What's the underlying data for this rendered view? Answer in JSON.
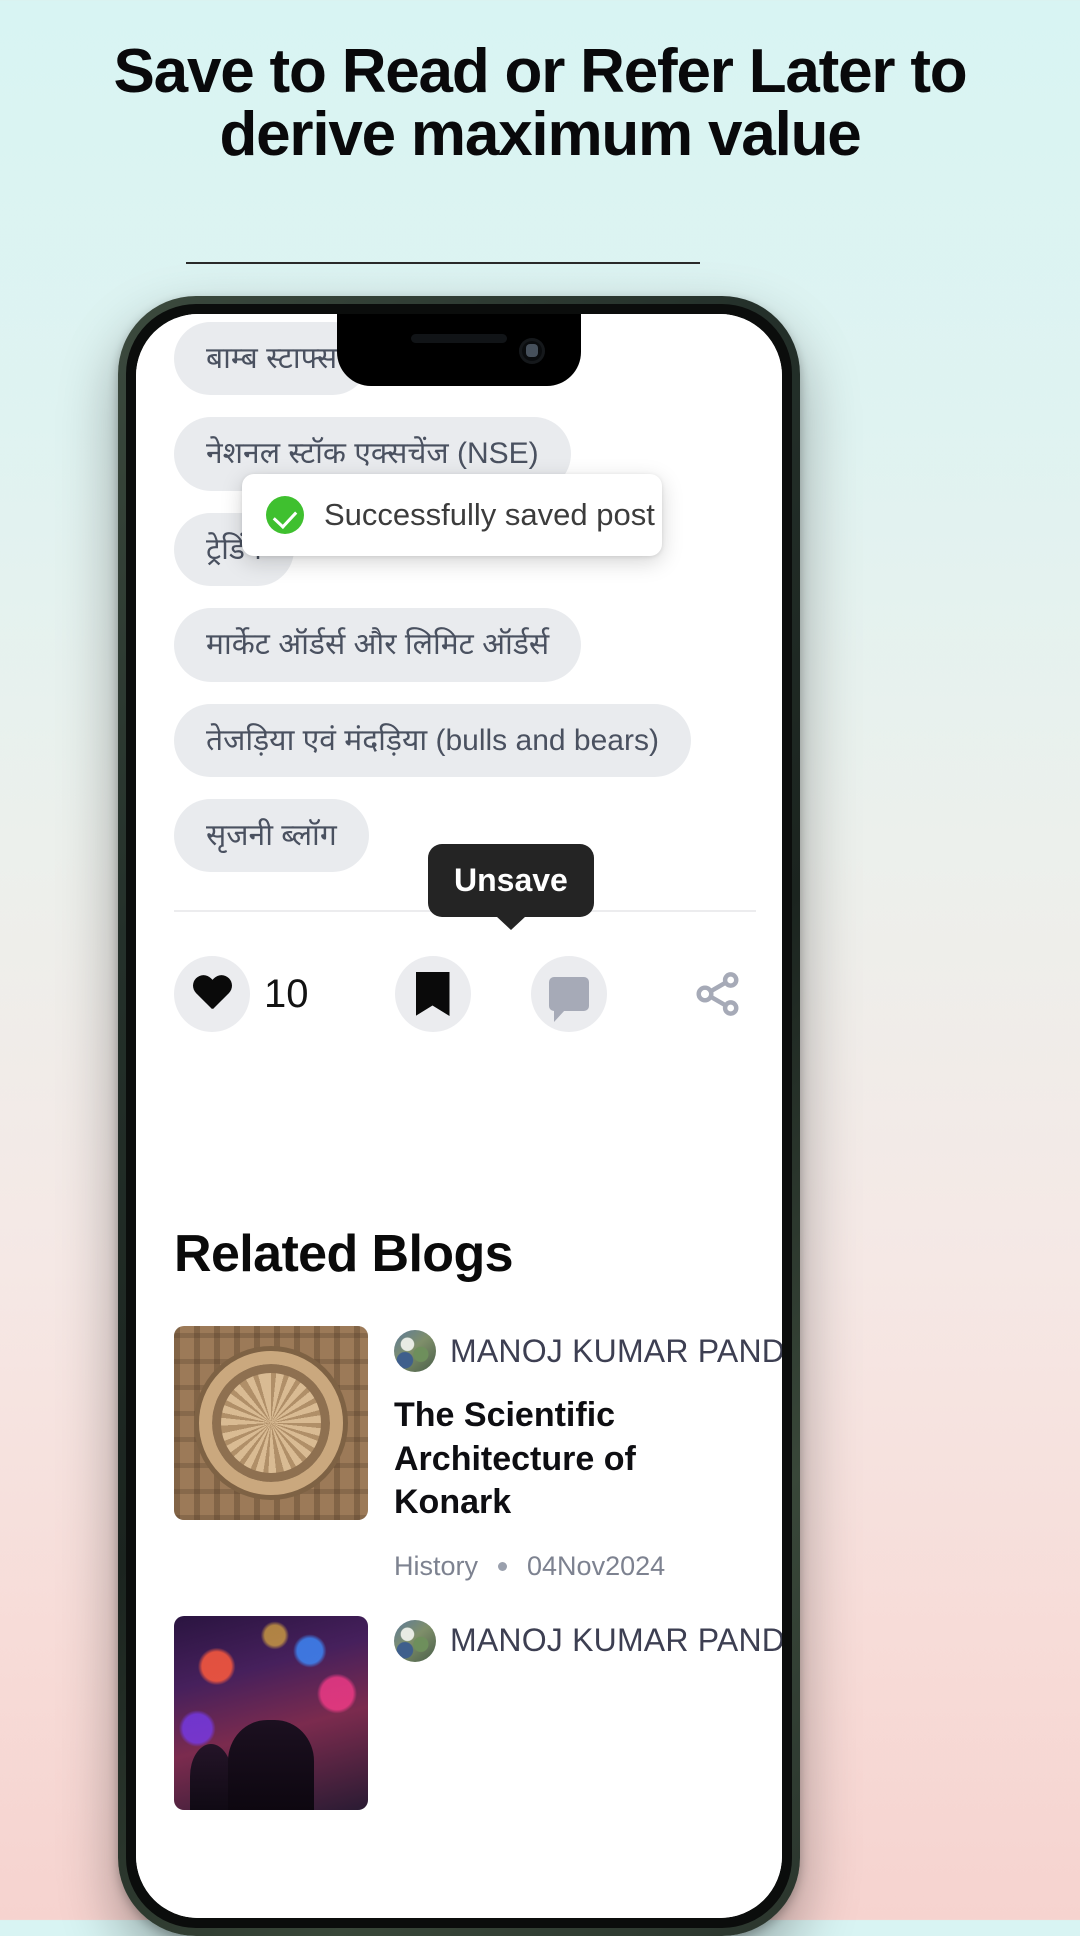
{
  "headline": "Save to Read or Refer Later to derive maximum value",
  "app": {
    "chips": [
      "बाम्ब स्टाफ्स",
      "नेशनल स्टॉक एक्सचेंज (NSE)",
      "ट्रेडिंग",
      "मार्केट ऑर्डर्स और लिमिट ऑर्डर्स",
      "तेजड़िया एवं मंदड़िया (bulls and bears)",
      "सृजनी ब्लॉग"
    ],
    "toast": {
      "message": "Successfully saved post",
      "icon": "check-circle-icon",
      "color": "#3fc02f"
    },
    "tooltip": {
      "label": "Unsave"
    },
    "actions": {
      "like": {
        "icon": "heart-icon",
        "count": "10"
      },
      "save": {
        "icon": "bookmark-icon"
      },
      "comment": {
        "icon": "comment-icon"
      },
      "share": {
        "icon": "share-icon"
      }
    },
    "related": {
      "title": "Related Blogs",
      "items": [
        {
          "author": "MANOJ KUMAR PANDA",
          "title": "The Scientific Architecture of Konark",
          "category": "History",
          "date": "04Nov2024",
          "thumb": "konark-wheel-thumbnail"
        },
        {
          "author": "MANOJ KUMAR PANDA",
          "title": "",
          "category": "",
          "date": "",
          "thumb": "concert-crowd-thumbnail"
        }
      ]
    }
  }
}
